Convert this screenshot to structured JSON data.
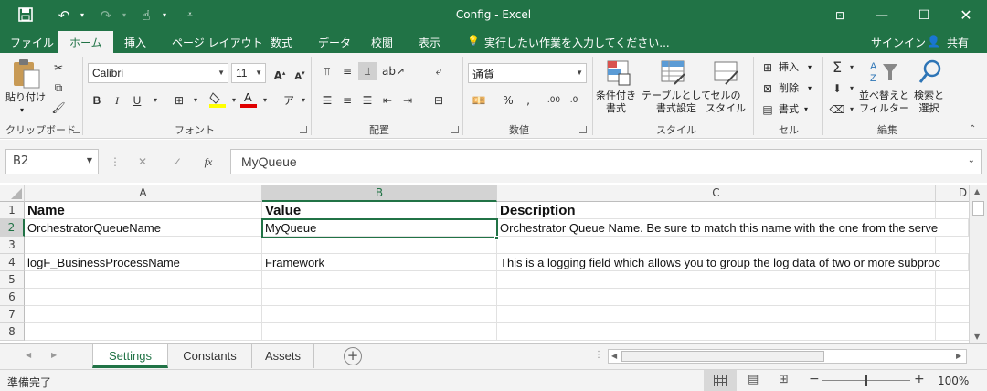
{
  "window": {
    "title": "Config - Excel"
  },
  "menu": {
    "tabs": [
      "ファイル",
      "ホーム",
      "挿入",
      "ページ レイアウト",
      "数式",
      "データ",
      "校閲",
      "表示"
    ],
    "tell_me": "実行したい作業を入力してください...",
    "signin": "サインイン",
    "share": "共有"
  },
  "ribbon": {
    "clipboard": {
      "paste": "貼り付け",
      "label": "クリップボード"
    },
    "font": {
      "name": "Calibri",
      "size": "11",
      "label": "フォント"
    },
    "alignment": {
      "label": "配置"
    },
    "number": {
      "format": "通貨",
      "label": "数値"
    },
    "styles": {
      "conditional": "条件付き\n書式",
      "table": "テーブルとして\n書式設定",
      "cell": "セルの\nスタイル",
      "label": "スタイル"
    },
    "cells": {
      "insert": "挿入",
      "delete": "削除",
      "format": "書式",
      "label": "セル"
    },
    "editing": {
      "sort": "並べ替えと\nフィルター",
      "find": "検索と\n選択",
      "label": "編集"
    }
  },
  "formula_bar": {
    "name_box": "B2",
    "formula": "MyQueue"
  },
  "grid": {
    "columns": [
      "A",
      "B",
      "C",
      "D"
    ],
    "rows": [
      {
        "num": "1",
        "cells": [
          "Name",
          "Value",
          "Description"
        ]
      },
      {
        "num": "2",
        "cells": [
          "OrchestratorQueueName",
          "MyQueue",
          "Orchestrator Queue Name. Be sure to match this name with the one from the serve"
        ]
      },
      {
        "num": "3",
        "cells": [
          "",
          "",
          ""
        ]
      },
      {
        "num": "4",
        "cells": [
          "logF_BusinessProcessName",
          "Framework",
          "This is a logging field which allows you to group the log data of two or more subproc"
        ]
      },
      {
        "num": "5",
        "cells": [
          "",
          "",
          ""
        ]
      },
      {
        "num": "6",
        "cells": [
          "",
          "",
          ""
        ]
      },
      {
        "num": "7",
        "cells": [
          "",
          "",
          ""
        ]
      },
      {
        "num": "8",
        "cells": [
          "",
          "",
          ""
        ]
      }
    ]
  },
  "sheets": {
    "tabs": [
      "Settings",
      "Constants",
      "Assets"
    ],
    "active": "Settings"
  },
  "status": {
    "ready": "準備完了",
    "zoom": "100%",
    "zoom_minus": "−",
    "zoom_plus": "+"
  },
  "colors": {
    "accent": "#217346"
  }
}
